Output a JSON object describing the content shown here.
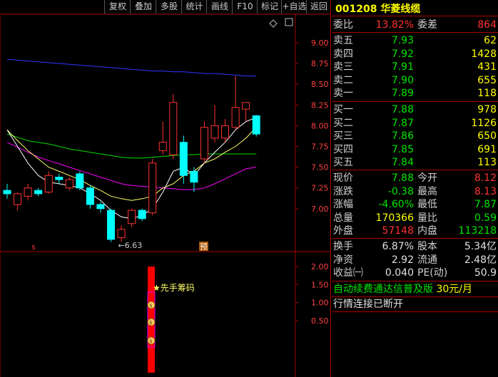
{
  "toolbar": {
    "buttons": [
      "复权",
      "叠加",
      "多股",
      "统计",
      "画线",
      "F10",
      "标记",
      "+自选",
      "返回"
    ]
  },
  "stock": {
    "code": "001208",
    "name": "华菱线缆"
  },
  "quote": {
    "weibi_label": "委比",
    "weibi_value": "13.82%",
    "weicha_label": "委差",
    "weicha_value": "864",
    "sell": [
      {
        "label": "卖五",
        "price": "7.93",
        "vol": "62"
      },
      {
        "label": "卖四",
        "price": "7.92",
        "vol": "1428"
      },
      {
        "label": "卖三",
        "price": "7.91",
        "vol": "431"
      },
      {
        "label": "卖二",
        "price": "7.90",
        "vol": "655"
      },
      {
        "label": "卖一",
        "price": "7.89",
        "vol": "118"
      }
    ],
    "buy": [
      {
        "label": "买一",
        "price": "7.88",
        "vol": "978"
      },
      {
        "label": "买二",
        "price": "7.87",
        "vol": "1126"
      },
      {
        "label": "买三",
        "price": "7.86",
        "vol": "650"
      },
      {
        "label": "买四",
        "price": "7.85",
        "vol": "691"
      },
      {
        "label": "买五",
        "price": "7.84",
        "vol": "113"
      }
    ],
    "stats1": [
      {
        "l1": "现价",
        "v1": "7.88",
        "c1": "grn",
        "l2": "今开",
        "v2": "8.12",
        "c2": "red"
      },
      {
        "l1": "涨跌",
        "v1": "-0.38",
        "c1": "grn",
        "l2": "最高",
        "v2": "8.13",
        "c2": "red"
      },
      {
        "l1": "涨幅",
        "v1": "-4.60%",
        "c1": "grn",
        "l2": "最低",
        "v2": "7.87",
        "c2": "grn"
      },
      {
        "l1": "总量",
        "v1": "170366",
        "c1": "yel",
        "l2": "量比",
        "v2": "0.59",
        "c2": "grn"
      },
      {
        "l1": "外盘",
        "v1": "57148",
        "c1": "red",
        "l2": "内盘",
        "v2": "113218",
        "c2": "grn"
      }
    ],
    "stats2": [
      {
        "l1": "换手",
        "v1": "6.87%",
        "l2": "股本",
        "v2": "5.34亿"
      },
      {
        "l1": "净资",
        "v1": "2.92",
        "l2": "流通",
        "v2": "2.48亿"
      },
      {
        "l1": "收益㈠",
        "v1": "0.040",
        "l2": "PE(动)",
        "v2": "50.9"
      }
    ],
    "promo": "自动续费通达信普及版",
    "promo_price": "30元/月",
    "status": "行情连接已断开"
  },
  "chart_data": {
    "type": "candlestick",
    "yaxis_main": [
      "9.00",
      "8.75",
      "8.50",
      "8.25",
      "8.00",
      "7.75",
      "7.50",
      "7.25",
      "7.00"
    ],
    "ylim_main": [
      6.85,
      9.1
    ],
    "yaxis_sub": [
      "2.00",
      "1.50",
      "1.00",
      "0.50"
    ],
    "ylim_sub": [
      0,
      2.2
    ],
    "low_annotation": "←6.63",
    "marker_s": "s",
    "marker_yu": "预",
    "signal_label": "★先手筹码",
    "candles": [
      {
        "o": 7.22,
        "c": 7.18,
        "h": 7.3,
        "l": 7.12
      },
      {
        "o": 7.05,
        "c": 7.18,
        "h": 7.2,
        "l": 6.98
      },
      {
        "o": 7.15,
        "c": 7.25,
        "h": 7.3,
        "l": 7.1
      },
      {
        "o": 7.22,
        "c": 7.18,
        "h": 7.25,
        "l": 7.15
      },
      {
        "o": 7.2,
        "c": 7.4,
        "h": 7.45,
        "l": 7.18
      },
      {
        "o": 7.38,
        "c": 7.35,
        "h": 7.42,
        "l": 7.3
      },
      {
        "o": 7.25,
        "c": 7.35,
        "h": 7.38,
        "l": 7.22
      },
      {
        "o": 7.42,
        "c": 7.25,
        "h": 7.45,
        "l": 7.22
      },
      {
        "o": 7.25,
        "c": 7.05,
        "h": 7.28,
        "l": 7.0
      },
      {
        "o": 7.05,
        "c": 7.0,
        "h": 7.08,
        "l": 6.95
      },
      {
        "o": 6.98,
        "c": 6.63,
        "h": 7.0,
        "l": 6.6
      },
      {
        "o": 6.65,
        "c": 6.75,
        "h": 6.8,
        "l": 6.6
      },
      {
        "o": 6.82,
        "c": 6.98,
        "h": 7.0,
        "l": 6.78
      },
      {
        "o": 6.98,
        "c": 6.88,
        "h": 7.0,
        "l": 6.85
      },
      {
        "o": 6.95,
        "c": 7.55,
        "h": 7.6,
        "l": 6.92
      },
      {
        "o": 7.7,
        "c": 7.8,
        "h": 8.05,
        "l": 7.65
      },
      {
        "o": 7.65,
        "c": 8.28,
        "h": 8.38,
        "l": 7.6
      },
      {
        "o": 7.8,
        "c": 7.4,
        "h": 7.88,
        "l": 7.3
      },
      {
        "o": 7.45,
        "c": 7.32,
        "h": 7.5,
        "l": 7.2
      },
      {
        "o": 7.6,
        "c": 7.98,
        "h": 8.05,
        "l": 7.55
      },
      {
        "o": 7.85,
        "c": 8.0,
        "h": 8.25,
        "l": 7.8
      },
      {
        "o": 7.85,
        "c": 8.0,
        "h": 8.08,
        "l": 7.8
      },
      {
        "o": 7.98,
        "c": 8.22,
        "h": 8.6,
        "l": 7.95
      },
      {
        "o": 8.2,
        "c": 8.28,
        "h": 8.28,
        "l": 8.05
      },
      {
        "o": 8.12,
        "c": 7.9,
        "h": 8.13,
        "l": 7.87
      }
    ],
    "ma_white": [
      7.95,
      7.75,
      7.55,
      7.4,
      7.32,
      7.3,
      7.28,
      7.25,
      7.18,
      7.1,
      6.98,
      6.9,
      6.88,
      6.92,
      7.0,
      7.2,
      7.45,
      7.5,
      7.4,
      7.55,
      7.68,
      7.8,
      7.95,
      8.05,
      8.1
    ],
    "ma_yellow": [
      7.95,
      7.82,
      7.7,
      7.6,
      7.5,
      7.45,
      7.4,
      7.35,
      7.28,
      7.22,
      7.15,
      7.12,
      7.1,
      7.12,
      7.15,
      7.25,
      7.3,
      7.4,
      7.45,
      7.55,
      7.6,
      7.68,
      7.75,
      7.85,
      7.98
    ],
    "ma_green": [
      7.9,
      7.86,
      7.82,
      7.8,
      7.78,
      7.75,
      7.72,
      7.7,
      7.68,
      7.66,
      7.64,
      7.62,
      7.61,
      7.61,
      7.62,
      7.63,
      7.64,
      7.65,
      7.65,
      7.66,
      7.66,
      7.66,
      7.66,
      7.66,
      7.66
    ],
    "ma_magenta": [
      7.8,
      7.74,
      7.68,
      7.62,
      7.58,
      7.54,
      7.5,
      7.46,
      7.42,
      7.38,
      7.34,
      7.3,
      7.28,
      7.27,
      7.26,
      7.25,
      7.24,
      7.23,
      7.23,
      7.25,
      7.3,
      7.36,
      7.42,
      7.48,
      7.5
    ],
    "ma_blue": [
      8.8,
      8.79,
      8.78,
      8.77,
      8.76,
      8.75,
      8.74,
      8.73,
      8.72,
      8.71,
      8.7,
      8.69,
      8.68,
      8.67,
      8.66,
      8.66,
      8.65,
      8.65,
      8.64,
      8.63,
      8.63,
      8.62,
      8.61,
      8.6,
      8.6
    ],
    "colors": {
      "up": "#ff3232",
      "down": "#00ffff",
      "ma_white": "#ffffff",
      "ma_yellow": "#ffff66",
      "ma_green": "#00dd00",
      "ma_magenta": "#ff00ff",
      "ma_blue": "#3333ff",
      "axis": "#aa0000",
      "text_axis": "#ff4040"
    }
  }
}
